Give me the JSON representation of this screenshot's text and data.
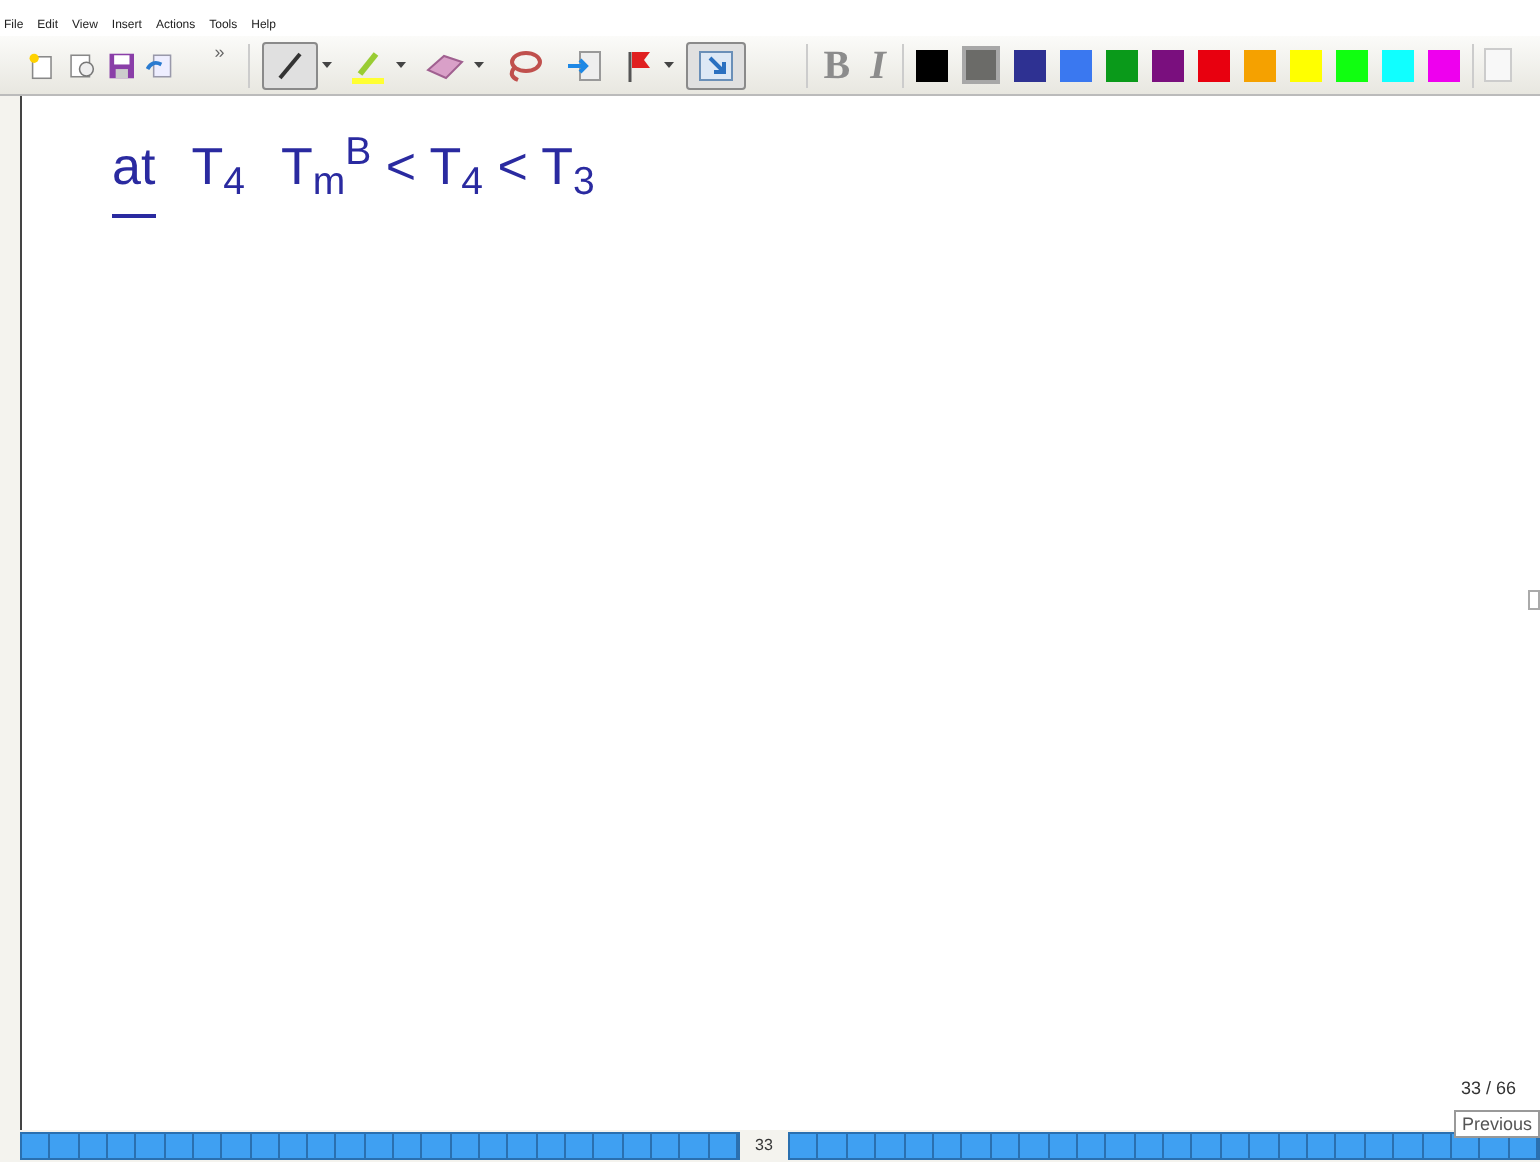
{
  "menu": [
    "File",
    "Edit",
    "View",
    "Insert",
    "Actions",
    "Tools",
    "Help"
  ],
  "toolbar": {
    "overflow": "»",
    "tools": [
      {
        "kind": "pen",
        "selected": true
      },
      {
        "kind": "highlighter",
        "selected": false
      },
      {
        "kind": "eraser",
        "selected": false
      },
      {
        "kind": "lasso",
        "selected": false
      },
      {
        "kind": "space",
        "selected": false
      },
      {
        "kind": "flag",
        "selected": false
      },
      {
        "kind": "select",
        "selected": true
      }
    ],
    "bold": "B",
    "italic": "I",
    "colors": [
      {
        "color": "#000000",
        "selected": false
      },
      {
        "color": "#6b6b68",
        "selected": true
      },
      {
        "color": "#2e3192",
        "selected": false
      },
      {
        "color": "#3a78f0",
        "selected": false
      },
      {
        "color": "#0a9a1a",
        "selected": false
      },
      {
        "color": "#7a0f7e",
        "selected": false
      },
      {
        "color": "#e8000f",
        "selected": false
      },
      {
        "color": "#f5a100",
        "selected": false
      },
      {
        "color": "#ffff00",
        "selected": false
      },
      {
        "color": "#10ff10",
        "selected": false
      },
      {
        "color": "#10ffff",
        "selected": false
      },
      {
        "color": "#ee00ee",
        "selected": false
      }
    ]
  },
  "ink": [
    {
      "text": "at",
      "underlined": true
    },
    {
      "text": "T$_{4}$",
      "underlined": false
    },
    {
      "text": "T$_{m}$$^{B}$ < T$_{4}$ < T$_{3}$",
      "underlined": false
    }
  ],
  "page_counter": "33 / 66",
  "tooltip": "Previous",
  "page_strip": {
    "current": "33"
  }
}
